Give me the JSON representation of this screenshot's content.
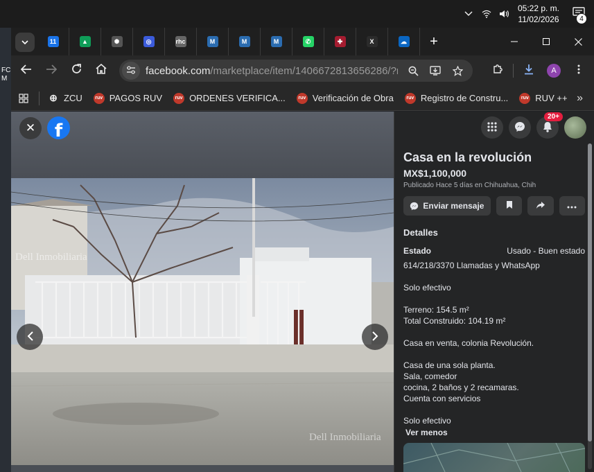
{
  "taskbar": {
    "time": "05:22 p. m.",
    "date": "11/02/2026",
    "notifications": "4"
  },
  "desktop": {
    "label": "FC\nM"
  },
  "tabs": [
    {
      "icon": "calendar-icon",
      "label": "11",
      "color": "#1a73e8"
    },
    {
      "icon": "google-drive-icon",
      "label": "▲",
      "color": "#0f9d58"
    },
    {
      "icon": "chatgpt-icon",
      "label": "✺",
      "color": "#555555"
    },
    {
      "icon": "tracker-icon",
      "label": "◎",
      "color": "#3b5bdb"
    },
    {
      "icon": "rhc-icon",
      "label": "rhc",
      "color": "#666666"
    },
    {
      "icon": "ruv-doc-icon",
      "label": "M",
      "color": "#2b6cb0"
    },
    {
      "icon": "ruv-doc-icon",
      "label": "M",
      "color": "#2b6cb0"
    },
    {
      "icon": "ruv-doc-icon",
      "label": "M",
      "color": "#2b6cb0"
    },
    {
      "icon": "whatsapp-icon",
      "label": "✆",
      "color": "#25d366"
    },
    {
      "icon": "shield-icon",
      "label": "✚",
      "color": "#a51c30"
    },
    {
      "icon": "x-icon",
      "label": "X",
      "color": "#2b2b2b"
    },
    {
      "icon": "onedrive-icon",
      "label": "☁",
      "color": "#0a66c2"
    }
  ],
  "omnibox": {
    "domain": "facebook.com",
    "path": "/marketplace/item/1406672813656286/?re..."
  },
  "profile": {
    "initial": "A"
  },
  "bookmarks": [
    {
      "label": "ZCU",
      "icon": "globe-icon",
      "color": "#e8e8e8",
      "text": "⊕"
    },
    {
      "label": "PAGOS RUV",
      "icon": "ruv-icon",
      "color": "#c0392b",
      "text": "ruv"
    },
    {
      "label": "ORDENES VERIFICA...",
      "icon": "ruv-icon",
      "color": "#c0392b",
      "text": "ruv"
    },
    {
      "label": "Verificación de Obra",
      "icon": "ruv-icon",
      "color": "#c0392b",
      "text": "ruv"
    },
    {
      "label": "Registro de Constru...",
      "icon": "ruv-icon",
      "color": "#c0392b",
      "text": "ruv"
    },
    {
      "label": "RUV ++",
      "icon": "ruv-icon",
      "color": "#c0392b",
      "text": "ruv"
    }
  ],
  "viewer": {
    "watermark": "Dell Inmobiliaria",
    "watermark_bottom": "Dell Inmobiliaria"
  },
  "facebook": {
    "notification_count": "20+"
  },
  "listing": {
    "title": "Casa en la revolución",
    "price": "MX$1,100,000",
    "posted": "Publicado Hace 5 días en Chihuahua, Chih",
    "send_message": "Enviar mensaje",
    "details_heading": "Detalles",
    "condition_label": "Estado",
    "condition_value": "Usado - Buen estado",
    "description": "614/218/3370 Llamadas y WhatsApp\n\nSolo efectivo\n\nTerreno: 154.5 m²\nTotal Construido: 104.19 m²\n\nCasa en venta, colonia Revolución.\n\nCasa de una sola planta.\nSala, comedor\ncocina, 2 baños y 2 recamaras.\nCuenta con servicios\n\nSolo efectivo",
    "see_less": "Ver menos"
  }
}
